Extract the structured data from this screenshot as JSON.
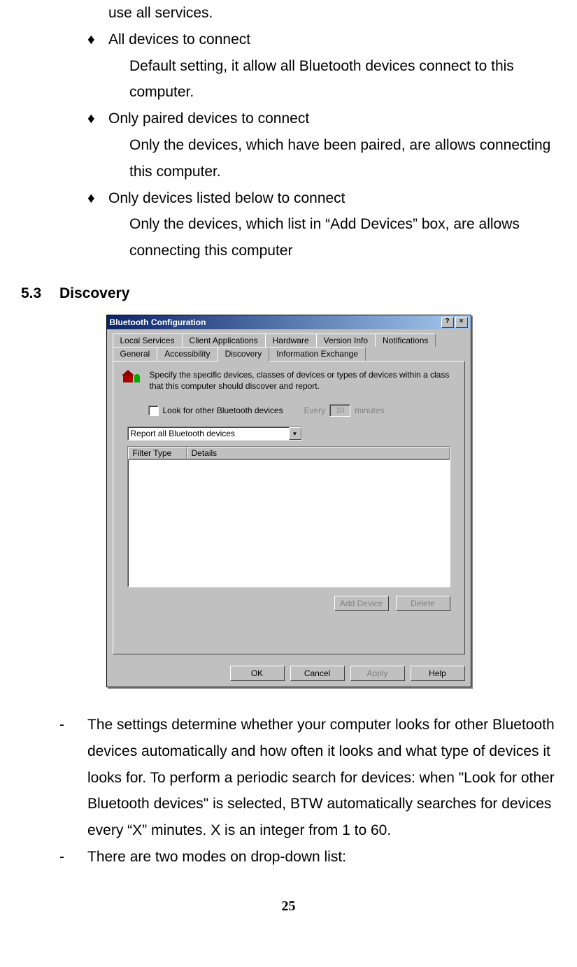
{
  "doc": {
    "continuation": "use all services.",
    "bullets": [
      {
        "title": "All devices to connect",
        "desc": "Default setting, it allow all Bluetooth devices connect to this computer."
      },
      {
        "title": "Only paired devices to connect",
        "desc": "Only the devices, which have been paired, are allows connecting this computer."
      },
      {
        "title": "Only devices listed below to connect",
        "desc": "Only the devices, which list in “Add Devices” box, are allows connecting this computer"
      }
    ],
    "section_num": "5.3",
    "section_title": "Discovery",
    "dash_items": [
      "The settings determine whether your computer looks for other Bluetooth devices automatically and how often it looks and what type of devices it looks for. To perform a periodic search for devices: when \"Look for other Bluetooth devices\" is selected, BTW automatically searches for devices every “X” minutes. X is an integer from 1 to 60.",
      "There are two modes on drop-down list:"
    ],
    "page_number": "25"
  },
  "dialog": {
    "title": "Bluetooth Configuration",
    "help_btn": "?",
    "close_btn": "×",
    "tabs_back": [
      "Local Services",
      "Client Applications",
      "Hardware",
      "Version Info",
      "Notifications"
    ],
    "tabs_front": [
      "General",
      "Accessibility",
      "Discovery",
      "Information Exchange"
    ],
    "active_tab": "Discovery",
    "panel_desc": "Specify the specific devices, classes of devices or types of devices within a class that this computer should discover and report.",
    "checkbox_label": "Look for other Bluetooth devices",
    "every_label": "Every",
    "every_value": "10",
    "minutes_label": "minutes",
    "dropdown_value": "Report all Bluetooth devices",
    "col_filter": "Filter Type",
    "col_details": "Details",
    "add_device": "Add Device",
    "delete": "Delete",
    "ok": "OK",
    "cancel": "Cancel",
    "apply": "Apply",
    "help": "Help"
  }
}
